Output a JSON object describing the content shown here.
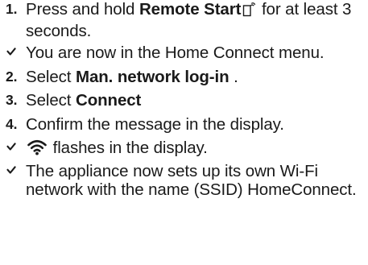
{
  "steps": [
    {
      "marker": "1.",
      "pre": "Press and hold ",
      "bold": "Remote Start",
      "post": " for at least 3 seconds.",
      "icon": "remote-start-icon"
    },
    {
      "marker": "check",
      "text": "You are now in the Home Connect menu."
    },
    {
      "marker": "2.",
      "pre": "Select ",
      "bold": "Man. network log-in",
      "post": " ."
    },
    {
      "marker": "3.",
      "pre": "Select ",
      "bold": "Connect"
    },
    {
      "marker": "4.",
      "text": "Confirm the message in the display."
    },
    {
      "marker": "check",
      "text": " flashes in the display.",
      "icon": "wifi-icon"
    },
    {
      "marker": "check",
      "text": "The appliance now sets up its own Wi-Fi network with the name (SSID) HomeConnect."
    }
  ],
  "colors": {
    "text": "#1a1a1a"
  }
}
